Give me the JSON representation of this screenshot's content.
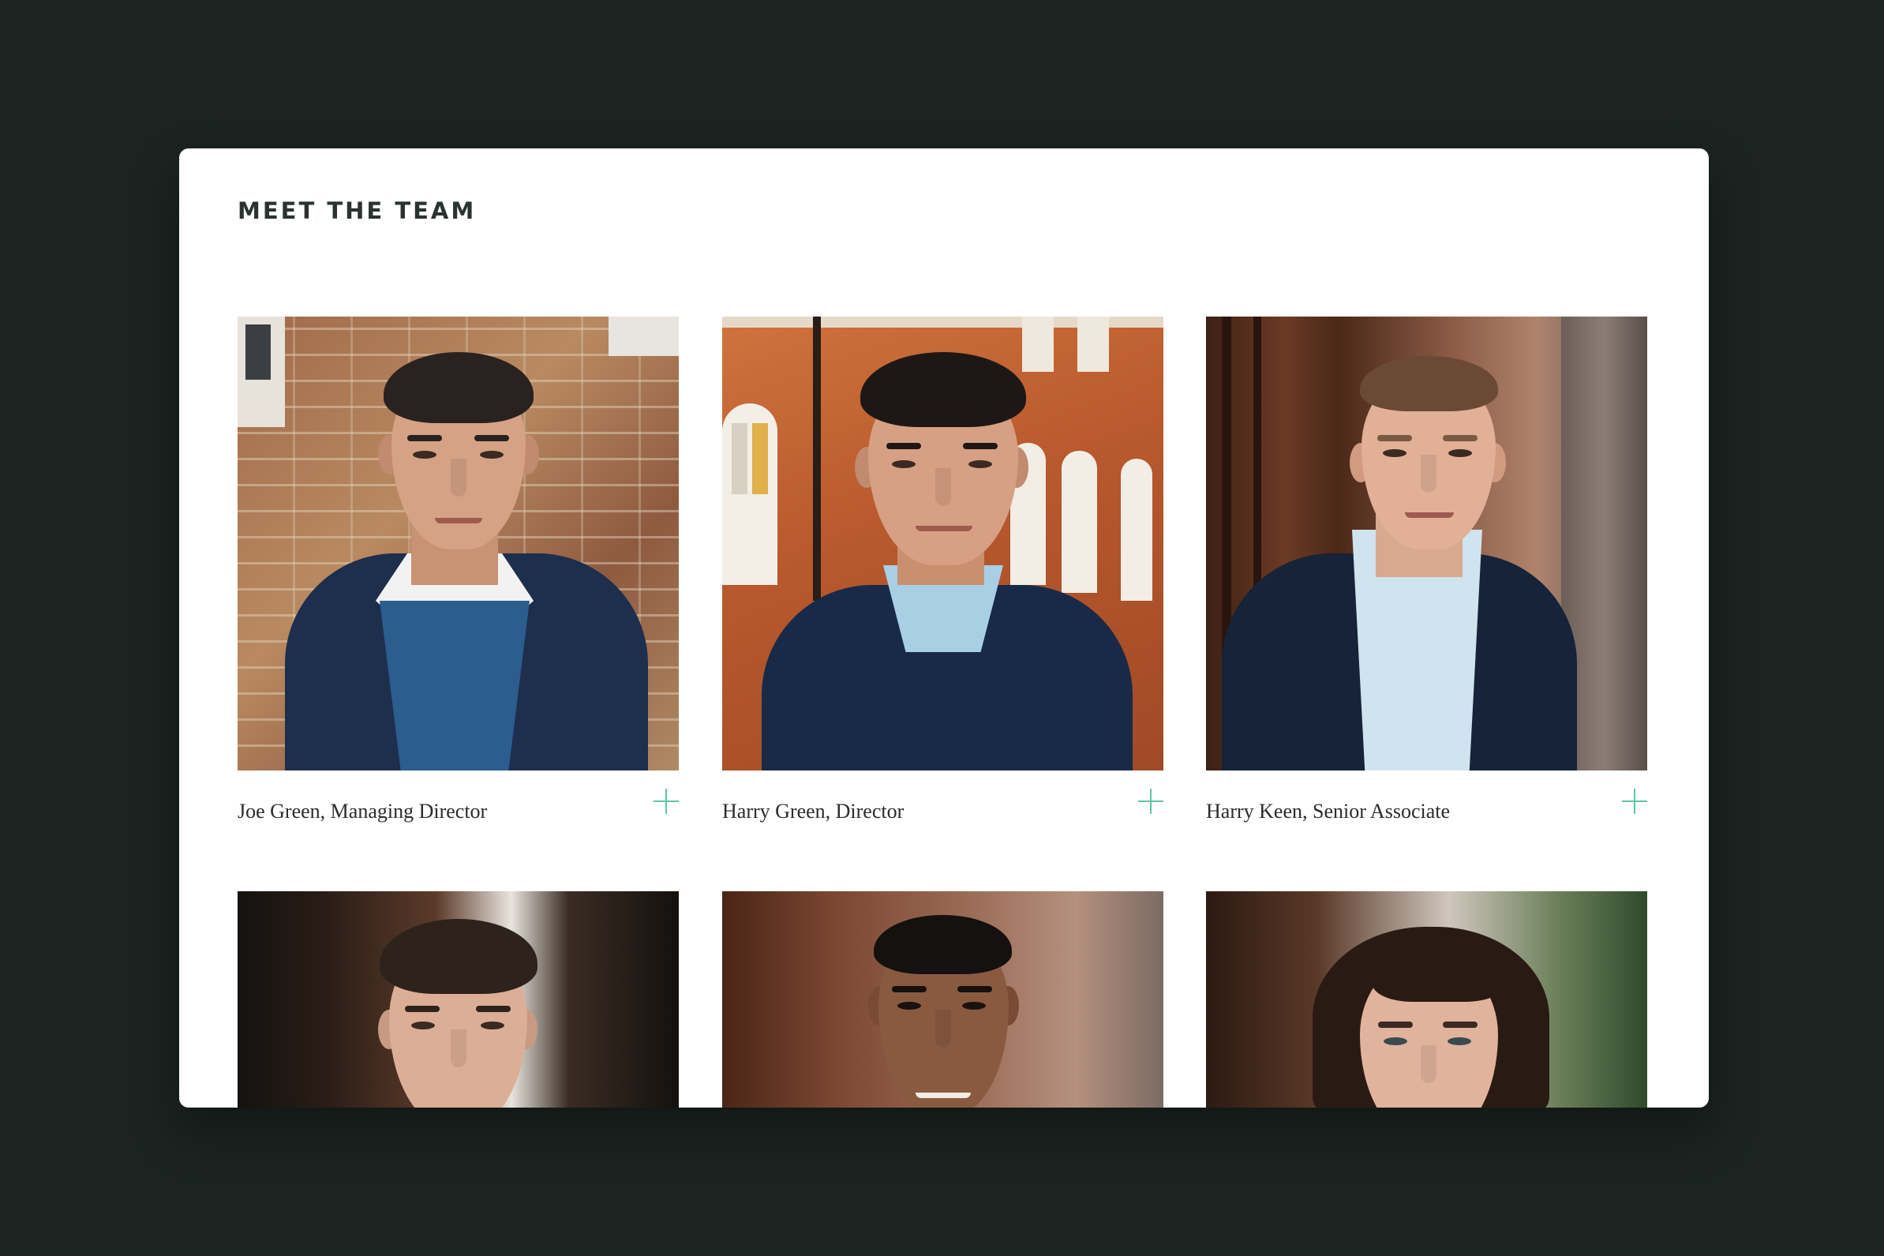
{
  "section": {
    "title": "MEET THE TEAM"
  },
  "team": [
    {
      "caption": "Joe Green, Managing Director",
      "expand_icon": "plus-icon"
    },
    {
      "caption": "Harry Green, Director",
      "expand_icon": "plus-icon"
    },
    {
      "caption": "Harry Keen, Senior Associate",
      "expand_icon": "plus-icon"
    }
  ],
  "colors": {
    "background": "#1b2420",
    "card": "#ffffff",
    "accent_plus": "#5ec5a6",
    "heading": "#2b332f"
  }
}
